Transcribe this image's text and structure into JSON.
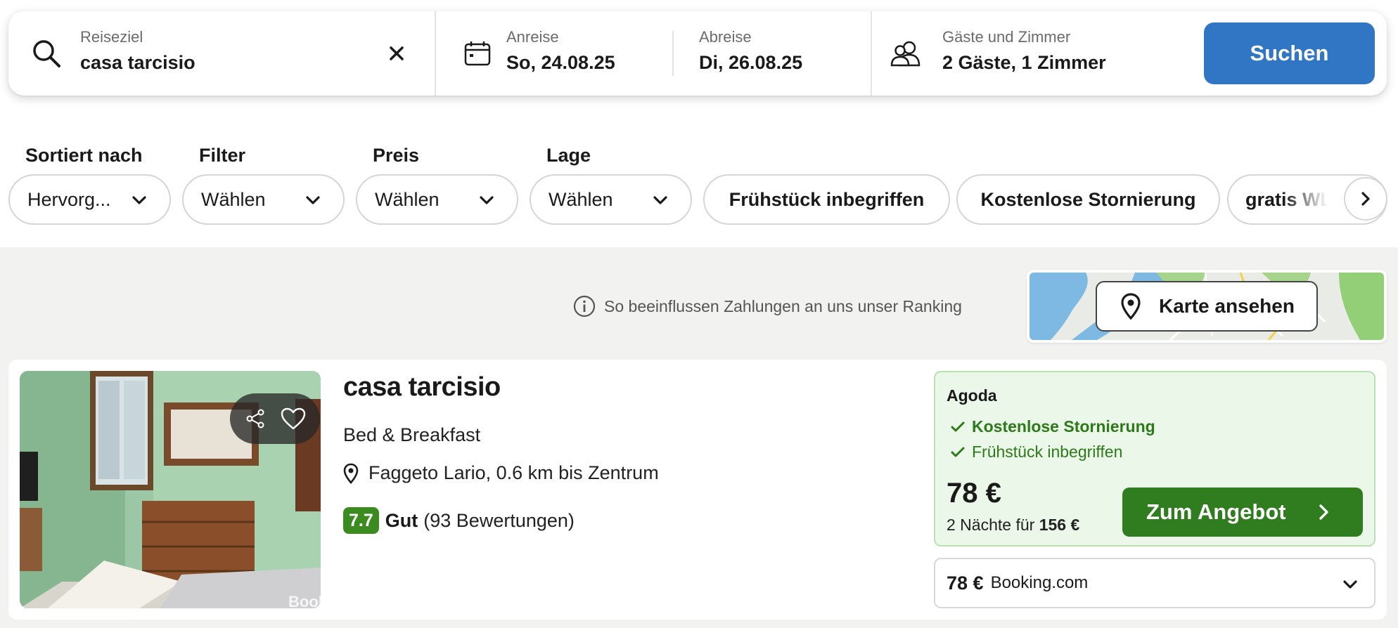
{
  "search": {
    "destination": {
      "label": "Reiseziel",
      "value": "casa tarcisio",
      "clear_icon": "close-icon"
    },
    "checkin": {
      "label": "Anreise",
      "value": "So, 24.08.25"
    },
    "checkout": {
      "label": "Abreise",
      "value": "Di, 26.08.25"
    },
    "guests": {
      "label": "Gäste und Zimmer",
      "value": "2 Gäste, 1 Zimmer"
    },
    "button": "Suchen"
  },
  "filters": {
    "sort": {
      "label": "Sortiert nach",
      "value": "Hervorg..."
    },
    "filter": {
      "label": "Filter",
      "value": "Wählen"
    },
    "price": {
      "label": "Preis",
      "value": "Wählen"
    },
    "location": {
      "label": "Lage",
      "value": "Wählen"
    },
    "chips": [
      "Frühstück inbegriffen",
      "Kostenlose Stornierung",
      "gratis WL"
    ]
  },
  "ranking_notice": "So beeinflussen Zahlungen an uns unser Ranking",
  "map_button": "Karte ansehen",
  "result": {
    "name": "casa tarcisio",
    "type": "Bed & Breakfast",
    "location": "Faggeto Lario, 0.6 km bis Zentrum",
    "rating": {
      "score": "7.7",
      "text": "Gut",
      "count": "(93 Bewertungen)"
    },
    "photo_watermark": "Booki",
    "offer": {
      "provider": "Agoda",
      "features": [
        "Kostenlose Stornierung",
        "Frühstück inbegriffen"
      ],
      "price": "78 €",
      "total_prefix": "2 Nächte für",
      "total_value": "156 €",
      "button": "Zum Angebot"
    },
    "alt_offer": {
      "price": "78 €",
      "provider": "Booking.com"
    }
  },
  "colors": {
    "primary": "#3176c4",
    "deal_green": "#2f7d1f",
    "rating_green": "#3c8b21",
    "offer_bg": "#ebf7e9"
  }
}
